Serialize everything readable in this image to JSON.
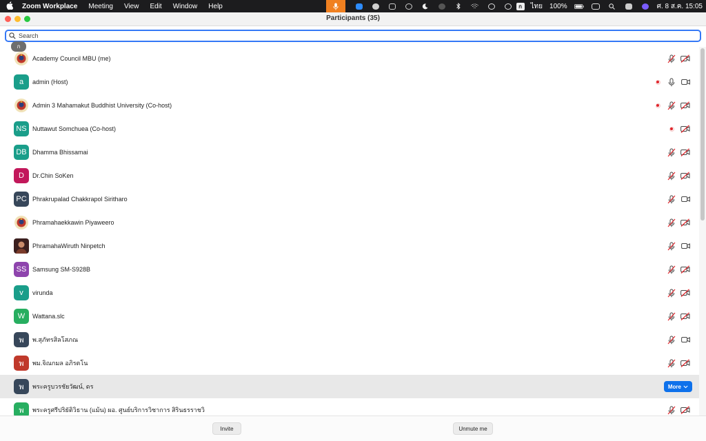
{
  "menubar": {
    "app_name": "Zoom Workplace",
    "menus": [
      "Meeting",
      "View",
      "Edit",
      "Window",
      "Help"
    ],
    "input_lang": "ก",
    "lang_label": "ไทย",
    "battery": "100%",
    "clock": "ศ. 8 ส.ค.  15:05"
  },
  "window": {
    "title": "Participants (35)"
  },
  "search": {
    "placeholder": "Search",
    "value": "",
    "kbd_hint": "ก"
  },
  "participants": [
    {
      "name": "Academy Council MBU (me)",
      "initials": "",
      "avatar_color": "#3a6a8a",
      "avatar_type": "image",
      "rec": false,
      "mic": "muted",
      "video": "off",
      "highlighted": false
    },
    {
      "name": "admin (Host)",
      "initials": "a",
      "avatar_color": "#1a9e8a",
      "avatar_type": "initials",
      "rec": true,
      "mic": "on",
      "video": "on",
      "highlighted": false
    },
    {
      "name": "Admin 3 Mahamakut Buddhist University (Co-host)",
      "initials": "",
      "avatar_color": "#d9a43a",
      "avatar_type": "image",
      "rec": true,
      "mic": "muted",
      "video": "off",
      "highlighted": false
    },
    {
      "name": "Nuttawut Somchuea (Co-host)",
      "initials": "NS",
      "avatar_color": "#1a9e8a",
      "avatar_type": "initials",
      "rec": true,
      "mic": "none",
      "video": "off",
      "highlighted": false
    },
    {
      "name": "Dhamma Bhissamai",
      "initials": "DB",
      "avatar_color": "#1a9e8a",
      "avatar_type": "initials",
      "rec": false,
      "mic": "muted",
      "video": "off",
      "highlighted": false
    },
    {
      "name": "Dr.Chin SoKen",
      "initials": "D",
      "avatar_color": "#c2185b",
      "avatar_type": "initials",
      "rec": false,
      "mic": "muted",
      "video": "off",
      "highlighted": false
    },
    {
      "name": "Phrakrupalad Chakkrapol Siritharo",
      "initials": "PC",
      "avatar_color": "#37475a",
      "avatar_type": "initials",
      "rec": false,
      "mic": "muted",
      "video": "on",
      "highlighted": false
    },
    {
      "name": "Phramahaekkawin Piyaweero",
      "initials": "",
      "avatar_color": "#d9a43a",
      "avatar_type": "image",
      "rec": false,
      "mic": "muted",
      "video": "off",
      "highlighted": false
    },
    {
      "name": "PhramahaWiruth Ninpetch",
      "initials": "",
      "avatar_color": "#5a2a2a",
      "avatar_type": "photo",
      "rec": false,
      "mic": "muted",
      "video": "on",
      "highlighted": false
    },
    {
      "name": "Samsung SM-S928B",
      "initials": "SS",
      "avatar_color": "#8e44ad",
      "avatar_type": "initials",
      "rec": false,
      "mic": "muted",
      "video": "off",
      "highlighted": false
    },
    {
      "name": "virunda",
      "initials": "v",
      "avatar_color": "#1a9e8a",
      "avatar_type": "initials",
      "rec": false,
      "mic": "muted",
      "video": "off",
      "highlighted": false
    },
    {
      "name": "Wattana.slc",
      "initials": "W",
      "avatar_color": "#27ae60",
      "avatar_type": "initials",
      "rec": false,
      "mic": "muted",
      "video": "off",
      "highlighted": false
    },
    {
      "name": "พ.สุภัทรสิลโสภณ",
      "initials": "พ",
      "avatar_color": "#37475a",
      "avatar_type": "initials",
      "rec": false,
      "mic": "muted",
      "video": "on",
      "highlighted": false
    },
    {
      "name": "พม.จิณกมล อภิรตโน",
      "initials": "พ",
      "avatar_color": "#c0392b",
      "avatar_type": "initials",
      "rec": false,
      "mic": "muted",
      "video": "off",
      "highlighted": false
    },
    {
      "name": "พระครูบวรชัยวัฒน์, ดร",
      "initials": "พ",
      "avatar_color": "#37475a",
      "avatar_type": "initials",
      "rec": false,
      "mic": "more",
      "video": "more",
      "highlighted": true,
      "more_label": "More"
    },
    {
      "name": "พระครูศรีปริยัติวิธาน (แม้น) ผอ. ศูนย์บริการวิชาการ สิรินธรราชวิ",
      "initials": "พ",
      "avatar_color": "#27ae60",
      "avatar_type": "initials",
      "rec": false,
      "mic": "muted",
      "video": "off",
      "highlighted": false
    }
  ],
  "footer": {
    "invite_label": "Invite",
    "unmute_label": "Unmute me"
  },
  "colors": {
    "accent": "#3478f6",
    "more_button": "#0e71eb",
    "muted_red": "#e0242a",
    "mic_pill": "#f08020"
  }
}
